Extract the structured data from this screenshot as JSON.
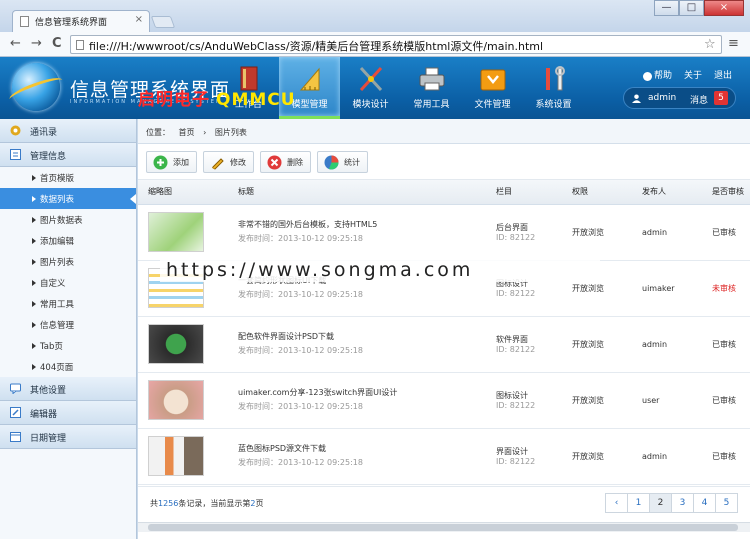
{
  "browser": {
    "tab_title": "信息管理系统界面",
    "tab_close": "×",
    "window_buttons": [
      "—",
      "□",
      "×"
    ],
    "nav_back": "←",
    "nav_forward": "→",
    "nav_reload": "C",
    "url": "file:///H:/wwwroot/cs/AnduWebClass/资源/精美后台管理系统模版html源文件/main.html",
    "star": "☆",
    "menu": "≡"
  },
  "header": {
    "title": "信息管理系统界面",
    "subtitle": "INFORMATION MANAGEMENT SYSTEM",
    "watermark_cn": "启明电子",
    "watermark_en": "QMMCU",
    "nav": [
      {
        "label": "工作台",
        "icon": "book-icon"
      },
      {
        "label": "模型管理",
        "icon": "ruler-icon"
      },
      {
        "label": "模块设计",
        "icon": "tools-icon"
      },
      {
        "label": "常用工具",
        "icon": "printer-icon"
      },
      {
        "label": "文件管理",
        "icon": "folder-icon"
      },
      {
        "label": "系统设置",
        "icon": "wrench-icon"
      }
    ],
    "links": {
      "help": "帮助",
      "about": "关于",
      "logout": "退出",
      "help_glyph": "?"
    },
    "user": {
      "name": "admin",
      "msg_label": "消息",
      "msg_count": "5"
    }
  },
  "sidebar": {
    "sections": [
      {
        "label": "通讯录"
      },
      {
        "label": "管理信息"
      },
      {
        "label": "其他设置"
      },
      {
        "label": "编辑器"
      },
      {
        "label": "日期管理"
      }
    ],
    "items": [
      "首页模版",
      "数据列表",
      "图片数据表",
      "添加编辑",
      "图片列表",
      "自定义",
      "常用工具",
      "信息管理",
      "Tab页",
      "404页面"
    ],
    "active_item": "数据列表"
  },
  "breadcrumb": {
    "prefix": "位置：",
    "home": "首页",
    "sep": "›",
    "current": "图片列表"
  },
  "toolbar": {
    "add": "添加",
    "edit": "修改",
    "delete": "删除",
    "stats": "统计"
  },
  "table": {
    "headers": [
      "缩略图",
      "标题",
      "栏目",
      "权限",
      "发布人",
      "是否审核"
    ],
    "rows": [
      {
        "title": "非常不错的国外后台模板，支持HTML5",
        "time": "发布时间：2013-10-12 09:25:18",
        "column": "后台界面",
        "id": "ID: 82122",
        "perm": "开放浏览",
        "author": "admin",
        "status": "已审核"
      },
      {
        "title": "一套简约形状图标UI下载",
        "time": "发布时间：2013-10-12 09:25:18",
        "column": "图标设计",
        "id": "ID: 82122",
        "perm": "开放浏览",
        "author": "uimaker",
        "status": "未审核"
      },
      {
        "title": "配色软件界面设计PSD下载",
        "time": "发布时间：2013-10-12 09:25:18",
        "column": "软件界面",
        "id": "ID: 82122",
        "perm": "开放浏览",
        "author": "admin",
        "status": "已审核"
      },
      {
        "title": "uimaker.com分享-123张switch界面UI设计",
        "time": "发布时间：2013-10-12 09:25:18",
        "column": "图标设计",
        "id": "ID: 82122",
        "perm": "开放浏览",
        "author": "user",
        "status": "已审核"
      },
      {
        "title": "蓝色图标PSD源文件下载",
        "time": "发布时间：2013-10-12 09:25:18",
        "column": "界面设计",
        "id": "ID: 82122",
        "perm": "开放浏览",
        "author": "admin",
        "status": "已审核"
      }
    ]
  },
  "pager": {
    "info_a": "共",
    "total": "1256",
    "info_b": "条记录，当前显示第",
    "current": "2",
    "info_c": "页",
    "pages": [
      "‹",
      "1",
      "2",
      "3",
      "4",
      "5"
    ]
  },
  "overlay": {
    "url_watermark": "https://www.songma.com"
  },
  "colors": {
    "header_blue": "#0b5fa5",
    "accent": "#3a8ee0",
    "badge_red": "#e23434",
    "unreviewed_red": "#d22"
  }
}
